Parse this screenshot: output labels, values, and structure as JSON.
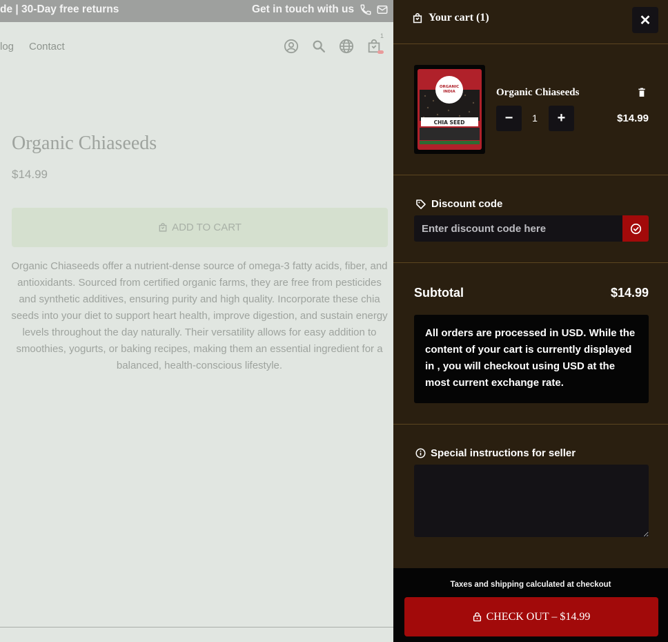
{
  "announcement": {
    "left_text": "de | 30-Day free returns",
    "right_text": "Get in touch with us"
  },
  "nav": {
    "links": [
      "log",
      "Contact"
    ],
    "cart_count": "1"
  },
  "product": {
    "title": "Organic Chiaseeds",
    "price": "$14.99",
    "add_to_cart_label": "ADD TO CART",
    "description": "Organic Chiaseeds offer a nutrient-dense source of omega-3 fatty acids, fiber, and antioxidants. Sourced from certified organic farms, they are free from pesticides and synthetic additives, ensuring purity and high quality. Incorporate these chia seeds into your diet to support heart health, improve digestion, and sustain energy levels throughout the day naturally. Their versatility allows for easy addition to smoothies, yogurts, or baking recipes, making them an essential ingredient for a balanced, health-conscious lifestyle."
  },
  "cart": {
    "title": "Your cart (1)",
    "close_label": "✕",
    "item": {
      "name": "Organic Chiaseeds",
      "quantity": "1",
      "price": "$14.99",
      "decrement_label": "−",
      "increment_label": "+",
      "package": {
        "brand_line1": "ORGANIC",
        "brand_line2": "INDIA",
        "product_label": "CHIA SEED"
      }
    },
    "discount": {
      "label": "Discount code",
      "placeholder": "Enter discount code here"
    },
    "subtotal": {
      "label": "Subtotal",
      "value": "$14.99"
    },
    "currency_notice": "All orders are processed in USD. While the content of your cart is currently displayed in , you will checkout using USD at the most current exchange rate.",
    "instructions": {
      "label": "Special instructions for seller",
      "value": ""
    },
    "footer": {
      "tax_note": "Taxes and shipping calculated at checkout",
      "checkout_label": "CHECK OUT – $14.99"
    }
  },
  "colors": {
    "drawer_bg": "#2a1f10",
    "accent_red": "#a20a0a",
    "dark_control": "#141216"
  }
}
